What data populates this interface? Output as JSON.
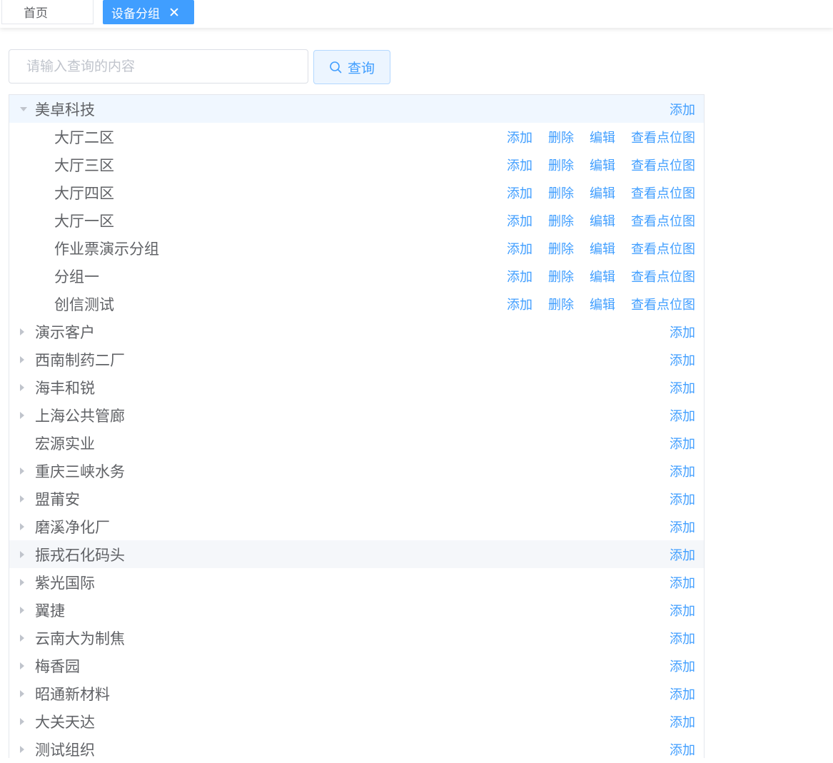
{
  "tabs": {
    "home": "首页",
    "active": "设备分组"
  },
  "search": {
    "placeholder": "请输入查询的内容",
    "button": "查询"
  },
  "actions": {
    "add": "添加",
    "delete": "删除",
    "edit": "编辑",
    "view_map": "查看点位图"
  },
  "colors": {
    "accent": "#409eff",
    "text": "#606266",
    "placeholder": "#c0c4cc"
  },
  "tree": {
    "root_expanded": {
      "label": "美卓科技",
      "children": [
        "大厅二区",
        "大厅三区",
        "大厅四区",
        "大厅一区",
        "作业票演示分组",
        "分组一",
        "创信测试"
      ]
    },
    "collapsed": [
      {
        "label": "演示客户",
        "has_children": true
      },
      {
        "label": "西南制药二厂",
        "has_children": true
      },
      {
        "label": "海丰和锐",
        "has_children": true
      },
      {
        "label": "上海公共管廊",
        "has_children": true
      },
      {
        "label": "宏源实业",
        "has_children": false
      },
      {
        "label": "重庆三峡水务",
        "has_children": true
      },
      {
        "label": "盟莆安",
        "has_children": true
      },
      {
        "label": "磨溪净化厂",
        "has_children": true
      },
      {
        "label": "振戎石化码头",
        "has_children": true
      },
      {
        "label": "紫光国际",
        "has_children": true
      },
      {
        "label": "翼捷",
        "has_children": true
      },
      {
        "label": "云南大为制焦",
        "has_children": true
      },
      {
        "label": "梅香园",
        "has_children": true
      },
      {
        "label": "昭通新材料",
        "has_children": true
      },
      {
        "label": "大关天达",
        "has_children": true
      },
      {
        "label": "测试组织",
        "has_children": true
      }
    ]
  }
}
